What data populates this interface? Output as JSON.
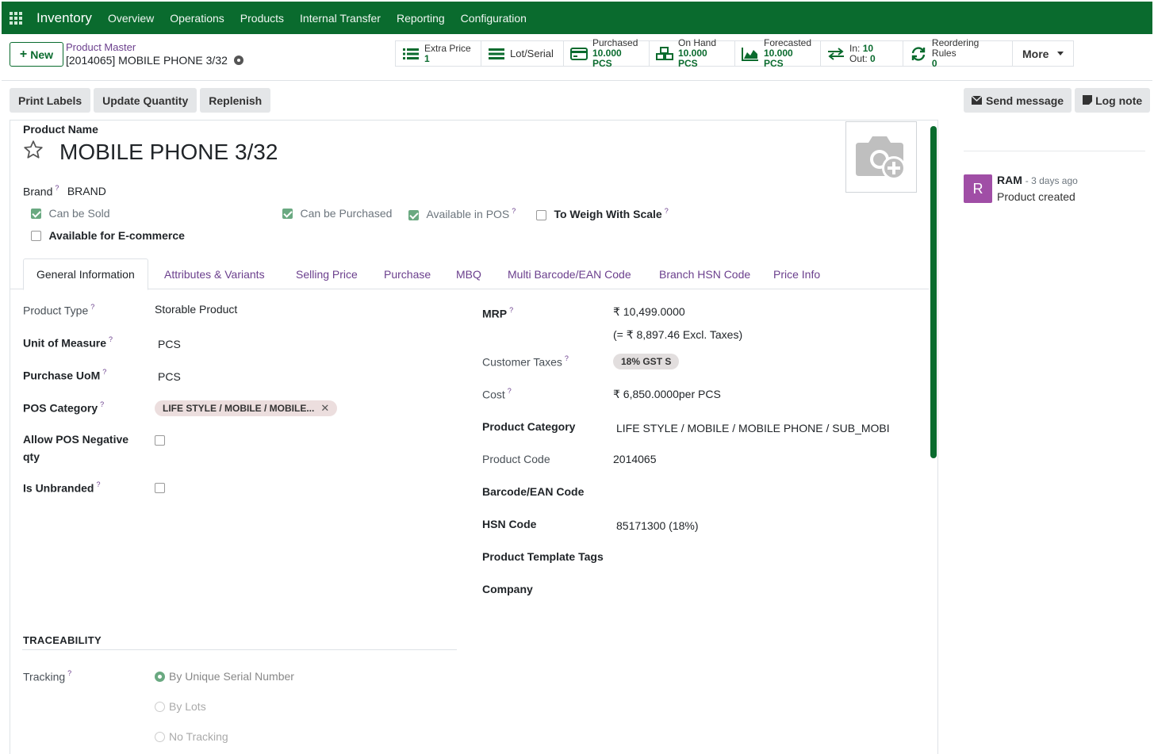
{
  "navbar": {
    "app": "Inventory",
    "menus": [
      "Overview",
      "Operations",
      "Products",
      "Internal Transfer",
      "Reporting",
      "Configuration"
    ]
  },
  "control": {
    "new_label": "New",
    "breadcrumb_parent": "Product Master",
    "breadcrumb_current": "[2014065] MOBILE PHONE 3/32"
  },
  "stats": [
    {
      "label": "Extra Price",
      "value": "1"
    },
    {
      "label": "Lot/Serial",
      "value": ""
    },
    {
      "label": "Purchased",
      "value": "10.000 PCS"
    },
    {
      "label": "On Hand",
      "value": "10.000 PCS"
    },
    {
      "label": "Forecasted",
      "value": "10.000 PCS"
    },
    {
      "label_in": "In:",
      "value_in": "10",
      "label_out": "Out:",
      "value_out": "0"
    },
    {
      "label": "Reordering Rules",
      "value": "0"
    },
    {
      "label": "More"
    }
  ],
  "actions": [
    "Print Labels",
    "Update Quantity",
    "Replenish"
  ],
  "chat_actions": [
    "Send message",
    "Log note"
  ],
  "product": {
    "name_label": "Product Name",
    "name": "MOBILE PHONE 3/32",
    "brand_label": "Brand",
    "brand": "BRAND",
    "checkboxes": [
      {
        "label": "Can be Sold",
        "checked": true
      },
      {
        "label": "Can be Purchased",
        "checked": true
      },
      {
        "label": "Available in POS",
        "checked": true
      },
      {
        "label": "To Weigh With Scale",
        "checked": false
      },
      {
        "label": "Available for E-commerce",
        "checked": false
      }
    ]
  },
  "tabs": [
    "General Information",
    "Attributes & Variants",
    "Selling Price",
    "Purchase",
    "MBQ",
    "Multi Barcode/EAN Code",
    "Branch HSN Code",
    "Price Info"
  ],
  "left_fields": {
    "product_type_label": "Product Type",
    "product_type": "Storable Product",
    "uom_label": "Unit of Measure",
    "uom": "PCS",
    "purchase_uom_label": "Purchase UoM",
    "purchase_uom": "PCS",
    "pos_category_label": "POS Category",
    "pos_category": "LIFE STYLE / MOBILE / MOBILE...",
    "allow_neg_label_1": "Allow POS Negative",
    "allow_neg_label_2": "qty",
    "unbranded_label": "Is Unbranded"
  },
  "right_fields": {
    "mrp_label": "MRP",
    "mrp": "₹ 10,499.0000",
    "mrp_excl": "(= ₹ 8,897.46 Excl. Taxes)",
    "customer_taxes_label": "Customer Taxes",
    "customer_taxes": "18% GST S",
    "cost_label": "Cost",
    "cost": "₹ 6,850.0000per PCS",
    "product_category_label": "Product Category",
    "product_category": "LIFE STYLE / MOBILE / MOBILE PHONE / SUB_MOBI",
    "product_code_label": "Product Code",
    "product_code": "2014065",
    "barcode_label": "Barcode/EAN Code",
    "hsn_label": "HSN Code",
    "hsn": "85171300 (18%)",
    "tags_label": "Product Template Tags",
    "company_label": "Company"
  },
  "traceability": {
    "title": "TRACEABILITY",
    "tracking_label": "Tracking",
    "options": [
      "By Unique Serial Number",
      "By Lots",
      "No Tracking"
    ],
    "selected": 0
  },
  "chatter": {
    "avatar": "R",
    "author": "RAM",
    "time": "- 3 days ago",
    "message": "Product created"
  },
  "colors": {
    "brand_green": "#0a6b2e",
    "link_purple": "#6b3f8d",
    "avatar": "#a04ea6"
  }
}
